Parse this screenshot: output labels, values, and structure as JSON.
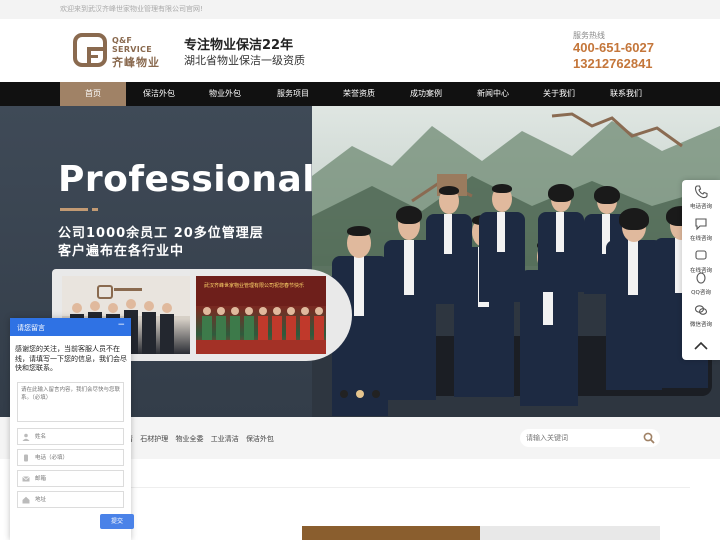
{
  "topbar": {
    "welcome": "欢迎来到武汉齐峰世家物业管理有限公司官网!"
  },
  "header": {
    "logo_en_1": "Q&F",
    "logo_en_2": "SERVICE",
    "logo_cn": "齐峰物业",
    "slogan_line1": "专注物业保洁22年",
    "slogan_line2": "湖北省物业保洁一级资质",
    "hotline_label": "服务热线",
    "hotline_1": "400-651-6027",
    "hotline_2": "13212762841"
  },
  "nav": {
    "items": [
      "首页",
      "保洁外包",
      "物业外包",
      "服务项目",
      "荣誉资质",
      "成功案例",
      "新闻中心",
      "关于我们",
      "联系我们"
    ],
    "active_index": 0
  },
  "banner": {
    "title": "Professional",
    "subtitle_1": "公司1000余员工 20多位管理层",
    "subtitle_2": "客户遍布在各行业中",
    "thumb_caption": "武汉齐峰世家物业管理有限公司祝您春节快乐",
    "slide_count": 3,
    "active_slide": 1
  },
  "tagsbar": {
    "tags": [
      "清",
      "石材护理",
      "物业全委",
      "工业清洁",
      "保洁外包"
    ],
    "search_placeholder": "请输入关键词"
  },
  "chat": {
    "title": "请您留言",
    "minimize": "−",
    "message": "感谢您的关注，当前客服人员不在线，请填写一下您的信息，我们会尽快和您联系。",
    "textarea_placeholder": "请在此输入留言内容，我们会尽快与您联系。（必填）",
    "name_placeholder": "姓名",
    "phone_placeholder": "电话（必填）",
    "email_placeholder": "邮箱",
    "address_placeholder": "地址",
    "submit_label": "提交"
  },
  "sidebar": {
    "items": [
      "电话咨询",
      "在线咨询",
      "在线咨询",
      "QQ咨询",
      "微信咨询"
    ]
  },
  "colors": {
    "accent": "#a08266",
    "hotline": "#c4763a",
    "chat_blue": "#2f72e4",
    "nav_bg": "#111111"
  }
}
